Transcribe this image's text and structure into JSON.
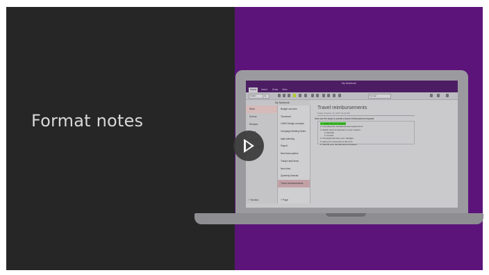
{
  "video": {
    "title": "Format notes",
    "play_icon": "play-icon"
  },
  "colors": {
    "left_panel": "#262626",
    "right_panel": "#5c147a",
    "highlight": "#3fc72b"
  },
  "app": {
    "window_title": "My Notebook",
    "ribbon_tabs": [
      "Home",
      "Insert",
      "Draw",
      "View"
    ],
    "font_field": "Calibri",
    "size_field": "11",
    "style_field": "Normal",
    "notebook_name": "My Notebook",
    "sections": [
      "Work",
      "School",
      "Recipes",
      "Travel",
      "Personal",
      "Class Notes"
    ],
    "sections_footer": "+ Section",
    "pages": [
      "Budget overview",
      "Timesheet",
      "LINKS Design concepts",
      "Campaign Meeting Notes",
      "Agile planning",
      "Payroll",
      "New team options",
      "Today's task items",
      "New hires",
      "Quarterly forecast",
      "Travel reimbursements"
    ],
    "pages_footer": "+ Page",
    "page_title": "Travel reimbursements",
    "page_date": "Friday, October 13, 2017    10:10 AM",
    "intro_text": "Here are the steps to submit a travel reimbursement request:",
    "steps": [
      "1.  Collect all your receipts",
      "2.  Complete the reimbursement request form",
      "3.  Attach proof of payment to your request",
      "a.  Receipt",
      "b.  Invoice",
      "4.  Get approval from your manager",
      "5.  Add your comments to the form",
      "6.  Submit your reimbursement request"
    ]
  }
}
